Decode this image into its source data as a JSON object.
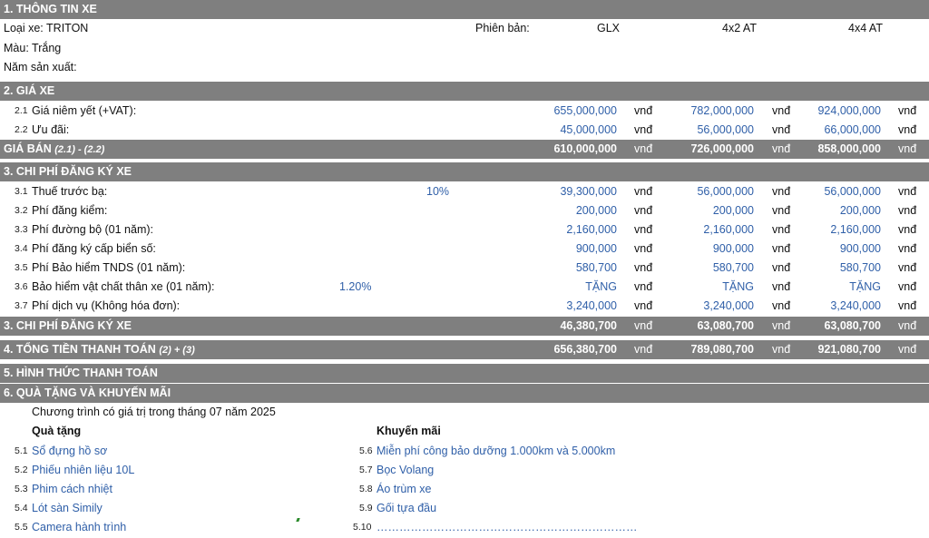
{
  "section1": {
    "title": "1. THÔNG TIN XE",
    "model_label": "Loại xe: TRITON",
    "color_label": "Màu: Trắng",
    "year_label": "Năm sản xuất:",
    "version_label": "Phiên bản:",
    "versions": [
      "GLX",
      "4x2 AT",
      "4x4 AT"
    ]
  },
  "section2": {
    "title": "2. GIÁ XE",
    "rows": [
      {
        "num": "2.1",
        "label": "Giá niêm yết (+VAT):",
        "values": [
          "655,000,000",
          "782,000,000",
          "924,000,000"
        ]
      },
      {
        "num": "2.2",
        "label": "Ưu đãi:",
        "values": [
          "45,000,000",
          "56,000,000",
          "66,000,000"
        ]
      }
    ],
    "sale_label": "GIÁ BÁN",
    "sale_formula": "(2.1) - (2.2)",
    "sale_values": [
      "610,000,000",
      "726,000,000",
      "858,000,000"
    ]
  },
  "unit": "vnđ",
  "section3": {
    "title": "3. CHI PHÍ ĐĂNG KÝ XE",
    "rows": [
      {
        "num": "3.1",
        "label": "Thuế trước bạ:",
        "rate": "10%",
        "values": [
          "39,300,000",
          "56,000,000",
          "56,000,000"
        ]
      },
      {
        "num": "3.2",
        "label": "Phí đăng kiểm:",
        "rate": "",
        "values": [
          "200,000",
          "200,000",
          "200,000"
        ]
      },
      {
        "num": "3.3",
        "label": "Phí đường bộ (01 năm):",
        "rate": "",
        "values": [
          "2,160,000",
          "2,160,000",
          "2,160,000"
        ]
      },
      {
        "num": "3.4",
        "label": "Phí đăng ký cấp biển số:",
        "rate": "",
        "values": [
          "900,000",
          "900,000",
          "900,000"
        ]
      },
      {
        "num": "3.5",
        "label": "Phí Bảo hiểm TNDS (01 năm):",
        "rate": "",
        "values": [
          "580,700",
          "580,700",
          "580,700"
        ]
      },
      {
        "num": "3.6",
        "label": "Bảo hiểm vật chất thân xe (01 năm):",
        "rate": "1.20%",
        "values": [
          "TẶNG",
          "TẶNG",
          "TẶNG"
        ]
      },
      {
        "num": "3.7",
        "label": "Phí dịch vụ (Không hóa đơn):",
        "rate": "",
        "values": [
          "3,240,000",
          "3,240,000",
          "3,240,000"
        ]
      }
    ],
    "total_label": "3. CHI PHÍ ĐĂNG KÝ XE",
    "total_values": [
      "46,380,700",
      "63,080,700",
      "63,080,700"
    ]
  },
  "section4": {
    "title": "4. TỔNG TIỀN THANH TOÁN",
    "formula": "(2) + (3)",
    "values": [
      "656,380,700",
      "789,080,700",
      "921,080,700"
    ]
  },
  "section5": {
    "title": "5. HÌNH THỨC THANH TOÁN"
  },
  "section6": {
    "title": "6. QUÀ TẶNG VÀ KHUYẾN MÃI",
    "note": "Chương trình có giá trị trong tháng 07 năm 2025",
    "gifts_header": "Quà tặng",
    "promos_header": "Khuyến mãi",
    "gifts": [
      {
        "num": "5.1",
        "label": "Sổ đựng hồ sơ"
      },
      {
        "num": "5.2",
        "label": "Phiếu nhiên liệu 10L"
      },
      {
        "num": "5.3",
        "label": "Phim cách nhiệt"
      },
      {
        "num": "5.4",
        "label": "Lót sàn Simily"
      },
      {
        "num": "5.5",
        "label": "Camera hành trình"
      }
    ],
    "promos": [
      {
        "num": "5.6",
        "label": "Miễn phí công bảo dưỡng 1.000km và 5.000km"
      },
      {
        "num": "5.7",
        "label": "Bọc Volang"
      },
      {
        "num": "5.8",
        "label": "Áo trùm xe"
      },
      {
        "num": "5.9",
        "label": "Gối tựa đầu"
      },
      {
        "num": "5.10",
        "label": "……………………………………………………………"
      }
    ]
  },
  "colors": {
    "header_bg": "#7f7f7f",
    "value_blue": "#2f5fa8"
  }
}
